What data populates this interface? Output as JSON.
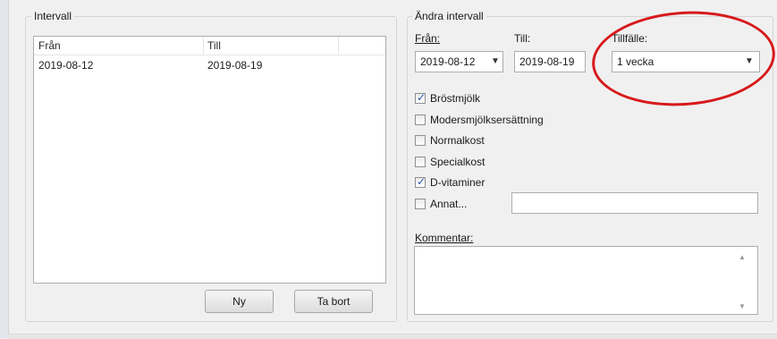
{
  "intervall_group": {
    "title": "Intervall",
    "columns": [
      "Från",
      "Till"
    ],
    "rows": [
      {
        "from": "2019-08-12",
        "to": "2019-08-19"
      }
    ],
    "new_button": "Ny",
    "delete_button": "Ta bort"
  },
  "edit_group": {
    "title": "Ändra intervall",
    "from_label": "Från:",
    "from_value": "2019-08-12",
    "to_label": "Till:",
    "to_value": "2019-08-19",
    "occasion_label": "Tillfälle:",
    "occasion_value": "1 vecka",
    "checkboxes": [
      {
        "label": "Bröstmjölk",
        "checked": true
      },
      {
        "label": "Modersmjölksersättning",
        "checked": false
      },
      {
        "label": "Normalkost",
        "checked": false
      },
      {
        "label": "Specialkost",
        "checked": false
      },
      {
        "label": "D-vitaminer",
        "checked": true
      },
      {
        "label": "Annat...",
        "checked": false
      }
    ],
    "other_value": "",
    "comment_label": "Kommentar:",
    "comment_value": ""
  },
  "colors": {
    "annotation": "#d7191c",
    "check": "#2a5bb5"
  }
}
